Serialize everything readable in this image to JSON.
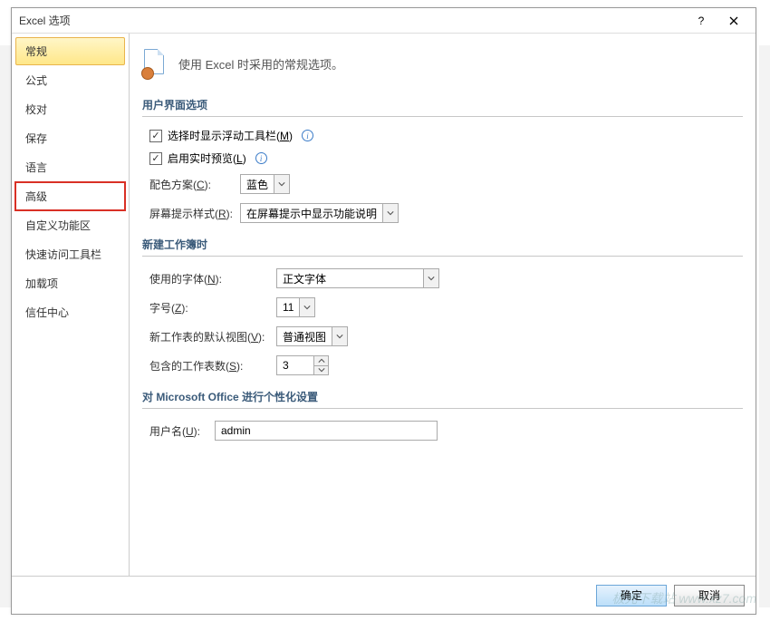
{
  "title": "Excel 选项",
  "sidebar": {
    "items": [
      {
        "label": "常规",
        "selected": true,
        "highlighted": false
      },
      {
        "label": "公式",
        "selected": false,
        "highlighted": false
      },
      {
        "label": "校对",
        "selected": false,
        "highlighted": false
      },
      {
        "label": "保存",
        "selected": false,
        "highlighted": false
      },
      {
        "label": "语言",
        "selected": false,
        "highlighted": false
      },
      {
        "label": "高级",
        "selected": false,
        "highlighted": true
      },
      {
        "label": "自定义功能区",
        "selected": false,
        "highlighted": false
      },
      {
        "label": "快速访问工具栏",
        "selected": false,
        "highlighted": false
      },
      {
        "label": "加载项",
        "selected": false,
        "highlighted": false
      },
      {
        "label": "信任中心",
        "selected": false,
        "highlighted": false
      }
    ]
  },
  "intro_text": "使用 Excel 时采用的常规选项。",
  "sections": {
    "ui": {
      "title": "用户界面选项",
      "mini_toolbar": {
        "label": "选择时显示浮动工具栏(",
        "hotkey": "M",
        "suffix": ")",
        "checked": true
      },
      "live_preview": {
        "label": "启用实时预览(",
        "hotkey": "L",
        "suffix": ")",
        "checked": true
      },
      "color_scheme": {
        "label": "配色方案(",
        "hotkey": "C",
        "suffix": "):",
        "value": "蓝色"
      },
      "screentip": {
        "label": "屏幕提示样式(",
        "hotkey": "R",
        "suffix": "):",
        "value": "在屏幕提示中显示功能说明"
      }
    },
    "newwb": {
      "title": "新建工作簿时",
      "font": {
        "label": "使用的字体(",
        "hotkey": "N",
        "suffix": "):",
        "value": "正文字体"
      },
      "size": {
        "label": "字号(",
        "hotkey": "Z",
        "suffix": "):",
        "value": "11"
      },
      "view": {
        "label": "新工作表的默认视图(",
        "hotkey": "V",
        "suffix": "):",
        "value": "普通视图"
      },
      "sheets": {
        "label": "包含的工作表数(",
        "hotkey": "S",
        "suffix": "):",
        "value": "3"
      }
    },
    "personal": {
      "title": "对 Microsoft Office 进行个性化设置",
      "username": {
        "label": "用户名(",
        "hotkey": "U",
        "suffix": "):",
        "value": "admin"
      }
    }
  },
  "footer": {
    "ok": "确定",
    "cancel": "取消"
  },
  "watermark": "极光下载站 www.xz7.com"
}
